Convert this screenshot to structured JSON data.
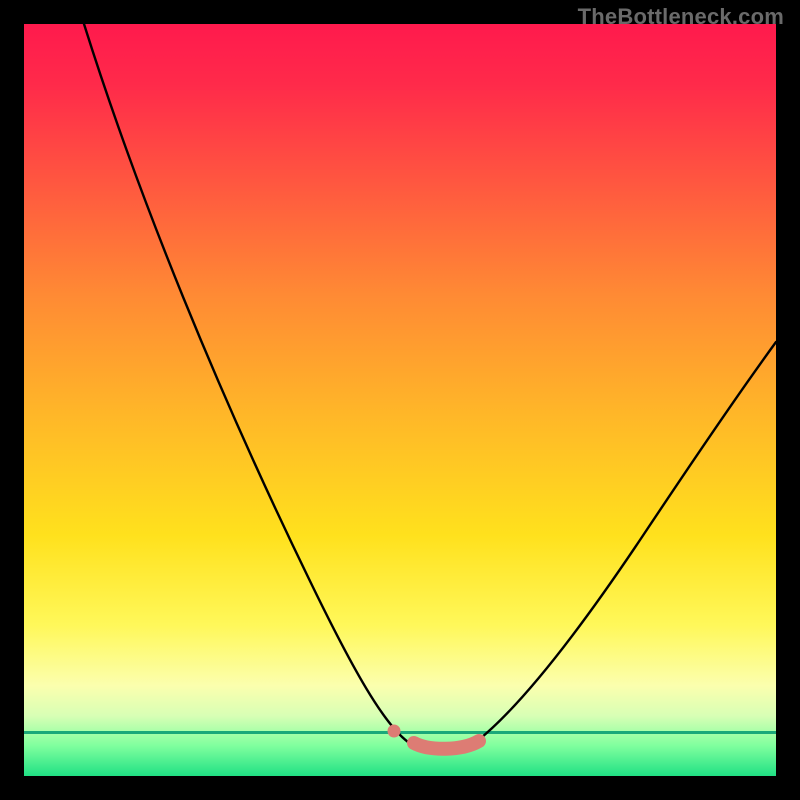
{
  "watermark": "TheBottleneck.com",
  "chart_data": {
    "type": "line",
    "title": "",
    "xlabel": "",
    "ylabel": "",
    "xlim": [
      0,
      100
    ],
    "ylim": [
      0,
      100
    ],
    "grid": false,
    "legend": false,
    "series": [
      {
        "name": "left-branch",
        "x": [
          8,
          12,
          17,
          22,
          27,
          32,
          37,
          42,
          46,
          49,
          51
        ],
        "y": [
          100,
          88,
          75,
          62,
          50,
          38,
          27,
          17,
          9,
          4,
          2
        ]
      },
      {
        "name": "right-branch",
        "x": [
          60,
          64,
          70,
          77,
          84,
          91,
          100
        ],
        "y": [
          2,
          5,
          12,
          22,
          33,
          44,
          58
        ]
      },
      {
        "name": "valley-floor",
        "x": [
          51,
          54,
          57,
          60
        ],
        "y": [
          2,
          1.6,
          1.6,
          2
        ]
      }
    ],
    "annotations": [
      {
        "name": "salmon-dot",
        "x": 49.2,
        "y": 3.5
      },
      {
        "name": "salmon-segment",
        "x_range": [
          51.5,
          60.5
        ],
        "y": 2
      }
    ]
  }
}
